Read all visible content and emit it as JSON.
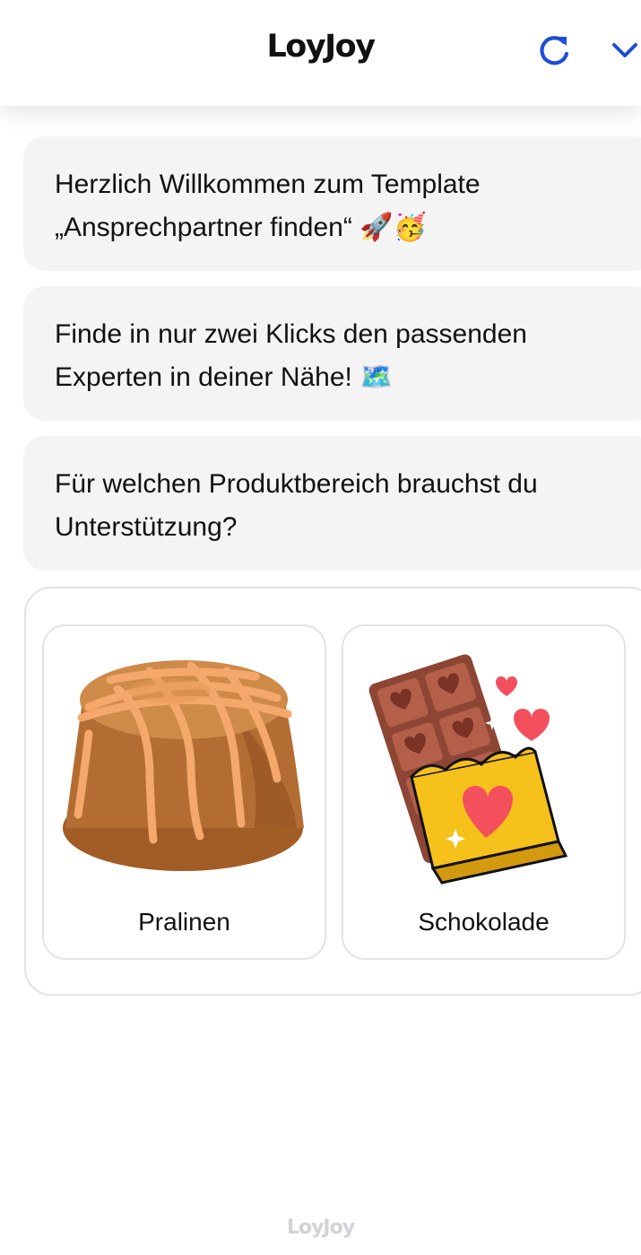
{
  "header": {
    "brand": "LoyJoy",
    "refresh_icon": "refresh-icon",
    "collapse_icon": "chevron-down-icon",
    "accent_color": "#1d4ed8"
  },
  "messages": [
    {
      "line1": "Herzlich Willkommen zum Template",
      "line2": "„Ansprechpartner finden“ 🚀🥳"
    },
    {
      "line1": "Finde in nur zwei Klicks den passenden",
      "line2": "Experten in deiner Nähe! 🗺️"
    },
    {
      "line1": "Für welchen Produktbereich brauchst du",
      "line2": "Unterstützung?"
    }
  ],
  "choices": [
    {
      "label": "Pralinen",
      "icon": "praline-icon"
    },
    {
      "label": "Schokolade",
      "icon": "chocolate-bar-icon"
    }
  ],
  "footer": {
    "brand": "LoyJoy"
  }
}
